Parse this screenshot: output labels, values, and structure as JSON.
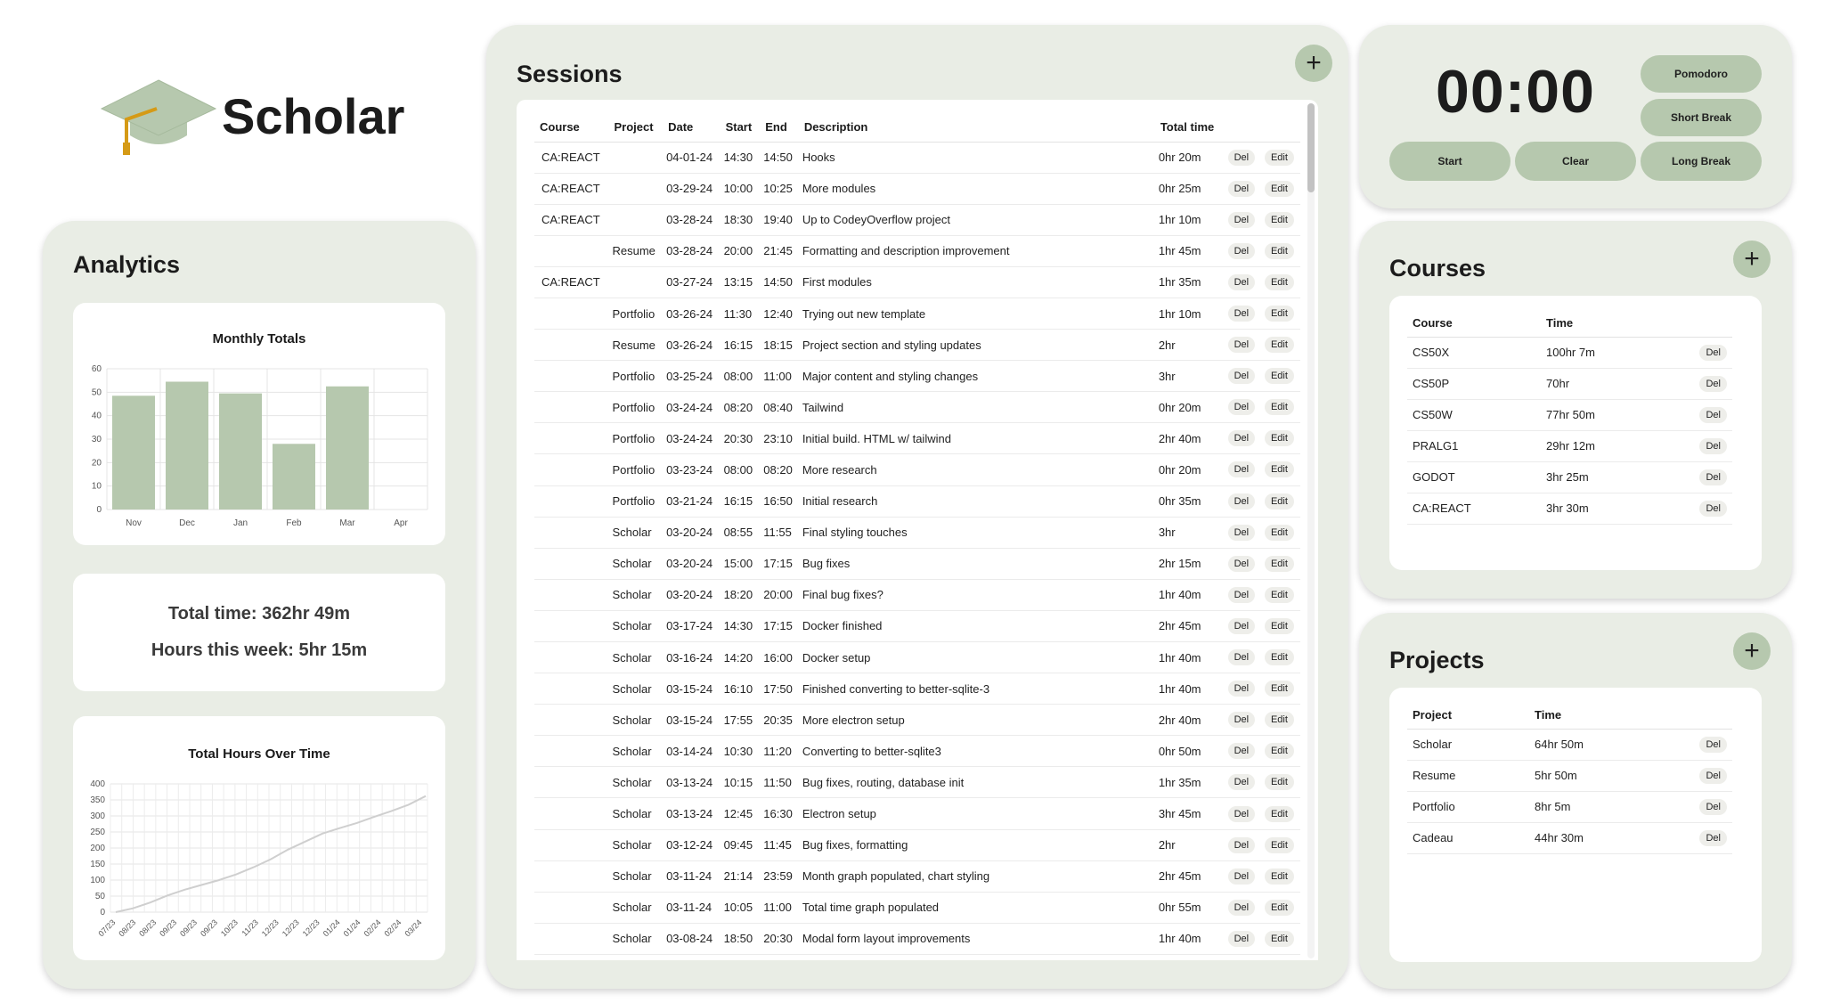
{
  "brand": {
    "name": "Scholar"
  },
  "colors": {
    "panel": "#e9ede5",
    "accent": "#b6c8ae",
    "bar": "#b6c8ae",
    "line": "#cfcfcf"
  },
  "analytics": {
    "title": "Analytics",
    "total_time": "Total time: 362hr 49m",
    "hours_week": "Hours this week: 5hr 15m"
  },
  "chart_data": [
    {
      "type": "bar",
      "title": "Monthly Totals",
      "categories": [
        "Nov",
        "Dec",
        "Jan",
        "Feb",
        "Mar",
        "Apr"
      ],
      "values": [
        48.5,
        54.5,
        49.5,
        28,
        52.5,
        0
      ],
      "ylim": [
        0,
        60
      ],
      "yticks": [
        0,
        10,
        20,
        30,
        40,
        50,
        60
      ],
      "grid": true
    },
    {
      "type": "line",
      "title": "Total Hours Over Time",
      "x": [
        "07/23",
        "08/23",
        "08/23",
        "09/23",
        "09/23",
        "09/23",
        "10/23",
        "11/23",
        "12/23",
        "12/23",
        "12/23",
        "01/24",
        "01/24",
        "02/24",
        "02/24",
        "03/24"
      ],
      "values": [
        0,
        12,
        30,
        52,
        70,
        85,
        100,
        118,
        140,
        165,
        195,
        220,
        245,
        262,
        278,
        297,
        315,
        335,
        362
      ],
      "ylim": [
        0,
        400
      ],
      "yticks": [
        0,
        50,
        100,
        150,
        200,
        250,
        300,
        350,
        400
      ],
      "grid": true
    }
  ],
  "sessions": {
    "title": "Sessions",
    "add_label": "+",
    "columns": [
      "Course",
      "Project",
      "Date",
      "Start",
      "End",
      "Description",
      "Total time"
    ],
    "del_label": "Del",
    "edit_label": "Edit",
    "rows": [
      [
        "CA:REACT",
        "",
        "04-01-24",
        "14:30",
        "14:50",
        "Hooks",
        "0hr 20m"
      ],
      [
        "CA:REACT",
        "",
        "03-29-24",
        "10:00",
        "10:25",
        "More modules",
        "0hr 25m"
      ],
      [
        "CA:REACT",
        "",
        "03-28-24",
        "18:30",
        "19:40",
        "Up to CodeyOverflow project",
        "1hr 10m"
      ],
      [
        "",
        "Resume",
        "03-28-24",
        "20:00",
        "21:45",
        "Formatting and description improvement",
        "1hr 45m"
      ],
      [
        "CA:REACT",
        "",
        "03-27-24",
        "13:15",
        "14:50",
        "First modules",
        "1hr 35m"
      ],
      [
        "",
        "Portfolio",
        "03-26-24",
        "11:30",
        "12:40",
        "Trying out new template",
        "1hr 10m"
      ],
      [
        "",
        "Resume",
        "03-26-24",
        "16:15",
        "18:15",
        "Project section and styling updates",
        "2hr"
      ],
      [
        "",
        "Portfolio",
        "03-25-24",
        "08:00",
        "11:00",
        "Major content and styling changes",
        "3hr"
      ],
      [
        "",
        "Portfolio",
        "03-24-24",
        "08:20",
        "08:40",
        "Tailwind",
        "0hr 20m"
      ],
      [
        "",
        "Portfolio",
        "03-24-24",
        "20:30",
        "23:10",
        "Initial build. HTML w/ tailwind",
        "2hr 40m"
      ],
      [
        "",
        "Portfolio",
        "03-23-24",
        "08:00",
        "08:20",
        "More research",
        "0hr 20m"
      ],
      [
        "",
        "Portfolio",
        "03-21-24",
        "16:15",
        "16:50",
        "Initial research",
        "0hr 35m"
      ],
      [
        "",
        "Scholar",
        "03-20-24",
        "08:55",
        "11:55",
        "Final styling touches",
        "3hr"
      ],
      [
        "",
        "Scholar",
        "03-20-24",
        "15:00",
        "17:15",
        "Bug fixes",
        "2hr 15m"
      ],
      [
        "",
        "Scholar",
        "03-20-24",
        "18:20",
        "20:00",
        "Final bug fixes?",
        "1hr 40m"
      ],
      [
        "",
        "Scholar",
        "03-17-24",
        "14:30",
        "17:15",
        "Docker finished",
        "2hr 45m"
      ],
      [
        "",
        "Scholar",
        "03-16-24",
        "14:20",
        "16:00",
        "Docker setup",
        "1hr 40m"
      ],
      [
        "",
        "Scholar",
        "03-15-24",
        "16:10",
        "17:50",
        "Finished converting to better-sqlite-3",
        "1hr 40m"
      ],
      [
        "",
        "Scholar",
        "03-15-24",
        "17:55",
        "20:35",
        "More electron setup",
        "2hr 40m"
      ],
      [
        "",
        "Scholar",
        "03-14-24",
        "10:30",
        "11:20",
        "Converting to better-sqlite3",
        "0hr 50m"
      ],
      [
        "",
        "Scholar",
        "03-13-24",
        "10:15",
        "11:50",
        "Bug fixes, routing, database init",
        "1hr 35m"
      ],
      [
        "",
        "Scholar",
        "03-13-24",
        "12:45",
        "16:30",
        "Electron setup",
        "3hr 45m"
      ],
      [
        "",
        "Scholar",
        "03-12-24",
        "09:45",
        "11:45",
        "Bug fixes, formatting",
        "2hr"
      ],
      [
        "",
        "Scholar",
        "03-11-24",
        "21:14",
        "23:59",
        "Month graph populated, chart styling",
        "2hr 45m"
      ],
      [
        "",
        "Scholar",
        "03-11-24",
        "10:05",
        "11:00",
        "Total time graph populated",
        "0hr 55m"
      ],
      [
        "",
        "Scholar",
        "03-08-24",
        "18:50",
        "20:30",
        "Modal form layout improvements",
        "1hr 40m"
      ]
    ]
  },
  "timer": {
    "display": "00:00",
    "pomodoro": "Pomodoro",
    "short_break": "Short Break",
    "long_break": "Long Break",
    "start": "Start",
    "clear": "Clear"
  },
  "courses": {
    "title": "Courses",
    "add_label": "+",
    "columns": [
      "Course",
      "Time"
    ],
    "del_label": "Del",
    "rows": [
      [
        "CS50X",
        "100hr 7m"
      ],
      [
        "CS50P",
        "70hr"
      ],
      [
        "CS50W",
        "77hr 50m"
      ],
      [
        "PRALG1",
        "29hr 12m"
      ],
      [
        "GODOT",
        "3hr 25m"
      ],
      [
        "CA:REACT",
        "3hr 30m"
      ]
    ]
  },
  "projects": {
    "title": "Projects",
    "add_label": "+",
    "columns": [
      "Project",
      "Time"
    ],
    "del_label": "Del",
    "rows": [
      [
        "Scholar",
        "64hr 50m"
      ],
      [
        "Resume",
        "5hr 50m"
      ],
      [
        "Portfolio",
        "8hr 5m"
      ],
      [
        "Cadeau",
        "44hr 30m"
      ]
    ]
  }
}
